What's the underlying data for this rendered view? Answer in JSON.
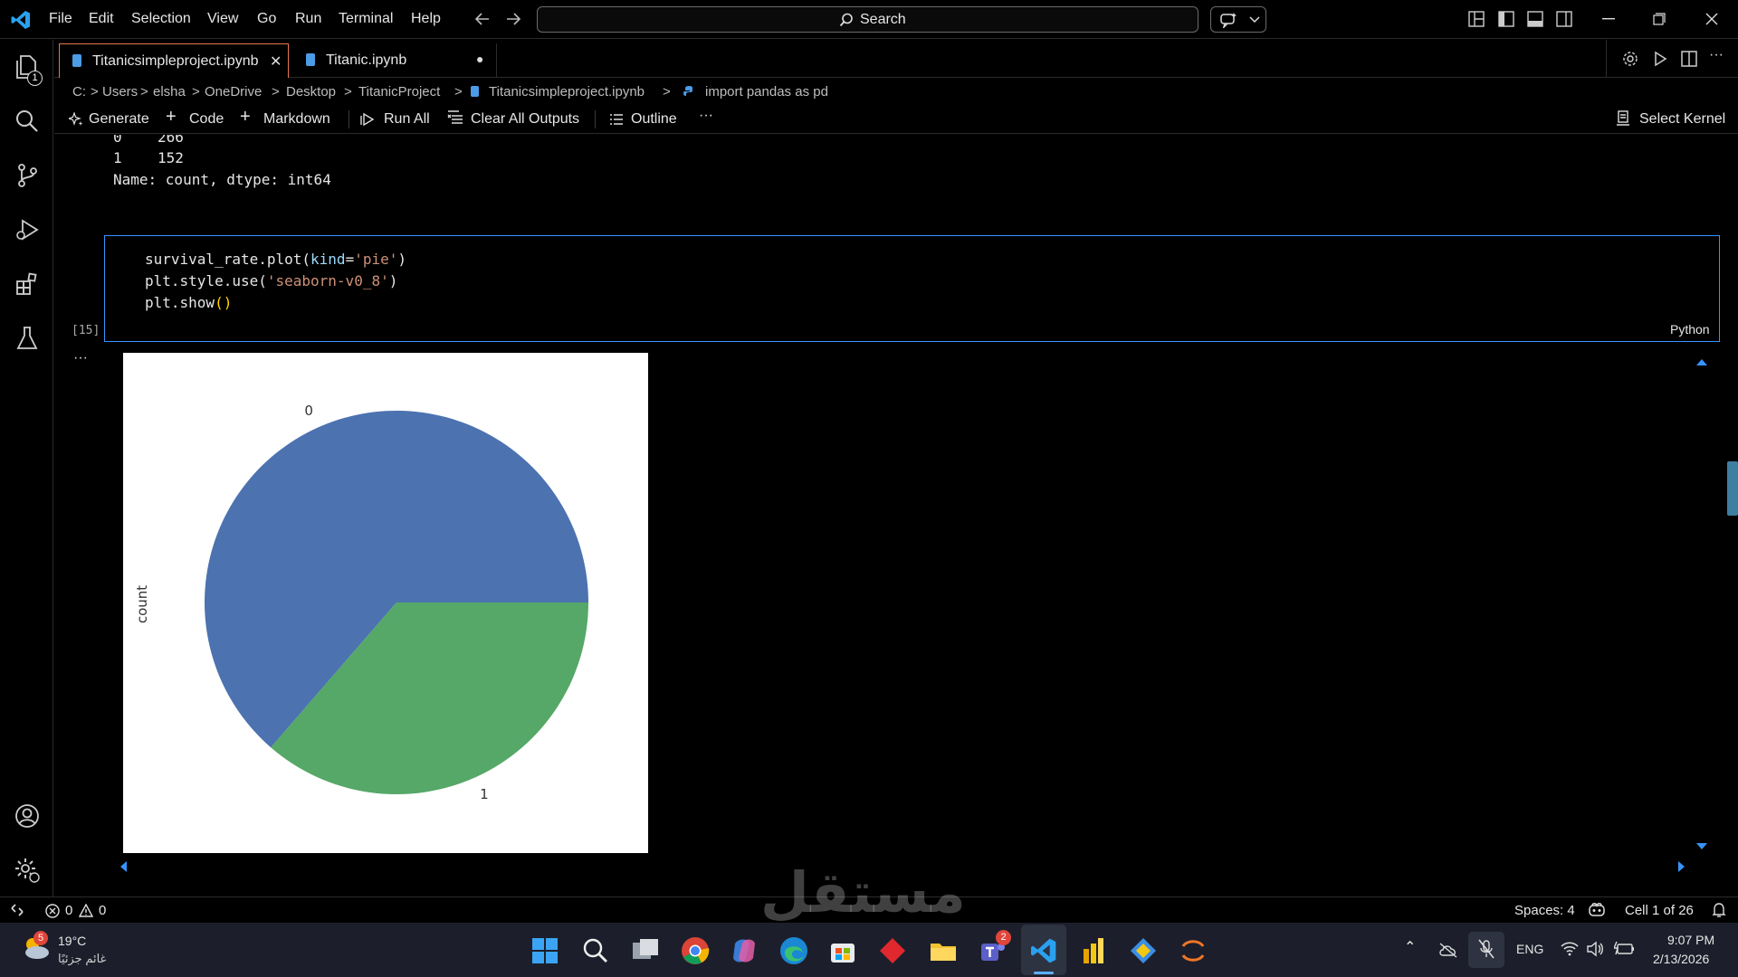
{
  "menu": [
    "File",
    "Edit",
    "Selection",
    "View",
    "Go",
    "Run",
    "Terminal",
    "Help"
  ],
  "search": {
    "label": "Search"
  },
  "activity": {
    "explorer_badge": "1"
  },
  "tabs": [
    {
      "label": "Titanicsimpleproject.ipynb",
      "close": "✕"
    },
    {
      "label": "Titanic.ipynb",
      "dirty": "●"
    }
  ],
  "breadcrumb": [
    "C:",
    ">",
    "Users",
    ">",
    "elsha",
    ">",
    "OneDrive",
    ">",
    "Desktop",
    ">",
    "TitanicProject",
    ">",
    "Titanicsimpleproject.ipynb",
    ">",
    "import pandas as pd"
  ],
  "toolbar": {
    "generate": "Generate",
    "code": "Code",
    "markdown": "Markdown",
    "run_all": "Run All",
    "clear_outputs": "Clear All Outputs",
    "outline": "Outline",
    "more": "···",
    "select_kernel": "Select Kernel"
  },
  "prev_output": {
    "line1_index": "0",
    "line1_value": "266",
    "line2_index": "1",
    "line2_value": "152",
    "line3": "Name: count, dtype: int64"
  },
  "cell": {
    "exec_count": "[15]",
    "language": "Python",
    "output_menu": "···",
    "code": {
      "l1_a": "survival_rate.plot(",
      "l1_b": "kind",
      "l1_c": "=",
      "l1_d": "'pie'",
      "l1_e": ")",
      "l2_a": "plt.style.use(",
      "l2_b": "'seaborn-v0_8'",
      "l2_c": ")",
      "l3_a": "plt.show",
      "l3_b": "()"
    }
  },
  "chart_data": {
    "type": "pie",
    "categories": [
      "0",
      "1"
    ],
    "values": [
      266,
      152
    ],
    "colors": [
      "#4c72b0",
      "#55a868"
    ],
    "ylabel": "count"
  },
  "statusbar": {
    "errors": "0",
    "warnings": "0",
    "spaces": "Spaces: 4",
    "cell_pos": "Cell 1 of 26"
  },
  "taskbar": {
    "weather_temp": "19°C",
    "weather_desc": "غائم جزئيًا",
    "weather_badge": "5",
    "teams_badge": "2",
    "lang": "ENG",
    "time": "9:07 PM",
    "date": "2/13/2026",
    "watermark": "مستقل"
  }
}
